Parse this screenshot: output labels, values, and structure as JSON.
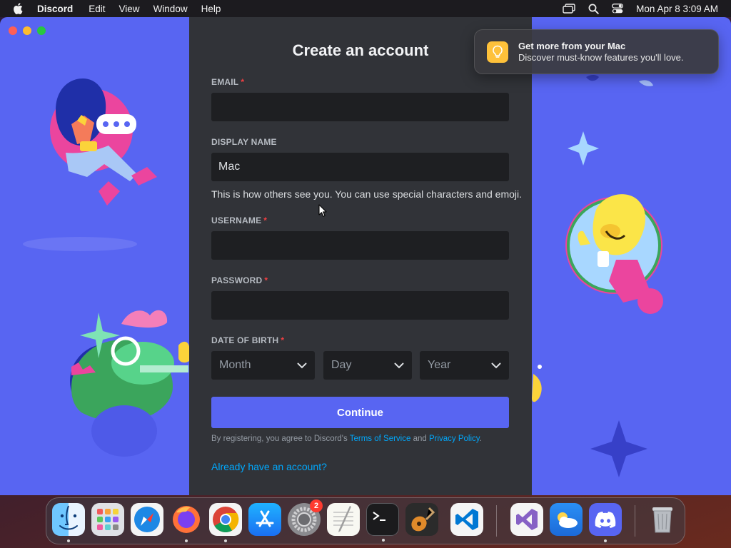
{
  "menubar": {
    "app_name": "Discord",
    "menus": [
      "Edit",
      "View",
      "Window",
      "Help"
    ],
    "datetime": "Mon Apr 8  3:09 AM"
  },
  "form": {
    "title": "Create an account",
    "email": {
      "label": "EMAIL",
      "required_mark": "*",
      "value": ""
    },
    "display_name": {
      "label": "DISPLAY NAME",
      "value": "Mac",
      "hint": "This is how others see you. You can use special characters and emoji."
    },
    "username": {
      "label": "USERNAME",
      "required_mark": "*",
      "value": ""
    },
    "password": {
      "label": "PASSWORD",
      "required_mark": "*",
      "value": ""
    },
    "date_of_birth": {
      "label": "DATE OF BIRTH",
      "required_mark": "*",
      "month_placeholder": "Month",
      "day_placeholder": "Day",
      "year_placeholder": "Year"
    },
    "continue_label": "Continue",
    "legal_prefix": "By registering, you agree to Discord's ",
    "terms_link": "Terms of Service",
    "legal_and": " and ",
    "privacy_link": "Privacy Policy",
    "legal_suffix": ".",
    "login_link": "Already have an account?"
  },
  "notification": {
    "title": "Get more from your Mac",
    "body": "Discover must-know features you'll love."
  },
  "dock": {
    "settings_badge": "2",
    "apps": [
      "Finder",
      "Launchpad",
      "Safari",
      "Firefox",
      "Chrome",
      "App Store",
      "System Settings",
      "TextEdit",
      "Terminal",
      "GarageBand",
      "VS Code",
      "Visual Studio",
      "Weather",
      "Discord",
      "Trash"
    ]
  },
  "colors": {
    "blurple": "#5865f2",
    "panel": "#313338",
    "input_bg": "#1e1f22",
    "link": "#00a8fc",
    "required": "#f23f42"
  }
}
